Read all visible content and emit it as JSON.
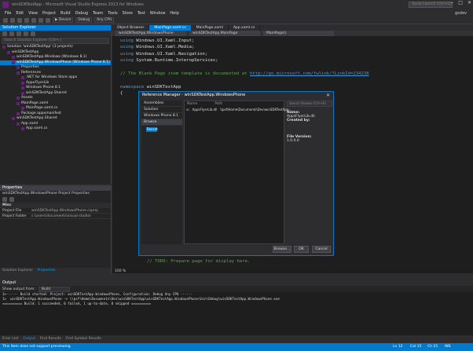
{
  "window": {
    "title": "winSDKTestApp - Microsoft Visual Studio Express 2013 for Windows",
    "quick_launch": "Quick Launch (Ctrl+Q)",
    "user": "gsdev"
  },
  "menu": [
    "File",
    "Edit",
    "View",
    "Project",
    "Build",
    "Debug",
    "Team",
    "Tools",
    "Store",
    "Test",
    "Window",
    "Help"
  ],
  "toolbar": {
    "device": "Device",
    "config": "Debug",
    "platform": "Any CPU"
  },
  "solution_explorer": {
    "title": "Solution Explorer",
    "search_placeholder": "Search Solution Explorer (Ctrl+;)",
    "items": [
      {
        "label": "Solution 'winSDKTestApp' (3 projects)",
        "indent": 0,
        "selected": false
      },
      {
        "label": "winSDKTestApp",
        "indent": 1,
        "selected": false
      },
      {
        "label": "winSDKTestApp.Windows (Windows 8.1)",
        "indent": 2,
        "selected": false
      },
      {
        "label": "winSDKTestApp.WindowsPhone (Windows Phone 8.1)",
        "indent": 2,
        "selected": true
      },
      {
        "label": "Properties",
        "indent": 3,
        "selected": false
      },
      {
        "label": "References",
        "indent": 3,
        "selected": false
      },
      {
        "label": ".NET for Windows Store apps",
        "indent": 4,
        "selected": false
      },
      {
        "label": "AppxFlyerLib",
        "indent": 4,
        "selected": false
      },
      {
        "label": "Windows Phone 8.1",
        "indent": 4,
        "selected": false
      },
      {
        "label": "winSDKTestApp.Shared",
        "indent": 4,
        "selected": false
      },
      {
        "label": "Assets",
        "indent": 3,
        "selected": false
      },
      {
        "label": "MainPage.xaml",
        "indent": 3,
        "selected": false
      },
      {
        "label": "MainPage.xaml.cs",
        "indent": 4,
        "selected": false
      },
      {
        "label": "Package.appxmanifest",
        "indent": 3,
        "selected": false
      },
      {
        "label": "winSDKTestApp.Shared",
        "indent": 2,
        "selected": false
      },
      {
        "label": "App.xaml",
        "indent": 3,
        "selected": false
      },
      {
        "label": "App.xaml.cs",
        "indent": 4,
        "selected": false
      }
    ]
  },
  "properties": {
    "title": "Properties",
    "subject": "winSDKTestApp.WindowsPhone  Project Properties",
    "section": "Misc",
    "rows": [
      {
        "k": "Project File",
        "v": "winSDKTestApp.WindowsPhone.csproj"
      },
      {
        "k": "Project Folder",
        "v": "c:\\users\\documents\\visual studio\\"
      }
    ],
    "tabs": [
      "Solution Explorer",
      "Properties"
    ]
  },
  "editor": {
    "tabs": [
      "Object Browser",
      "MainPage.xaml.cs",
      "MainPage.xaml",
      "App.xaml.cs"
    ],
    "nav": [
      "winSDKTestApp.WindowsPhone",
      "winSDKTestApp.MainPage",
      "MainPage()"
    ],
    "zoom": "100 %",
    "lines": [
      {
        "t": "using Windows.UI.Xaml.Input;",
        "c": "tx"
      },
      {
        "t": "using Windows.UI.Xaml.Media;",
        "c": "tx"
      },
      {
        "t": "using Windows.UI.Xaml.Navigation;",
        "c": "tx"
      },
      {
        "t": "using System.Runtime.InteropServices;",
        "c": "tx"
      },
      {
        "t": "",
        "c": "tx"
      },
      {
        "t": "// The Blank Page item template is documented at http://go.microsoft.com/fwlink/?LinkId=234238",
        "c": "cm"
      },
      {
        "t": "",
        "c": "tx"
      },
      {
        "t": "namespace winSDKTestApp",
        "c": "tx"
      },
      {
        "t": "{",
        "c": "tx"
      }
    ],
    "tail": "// TODO: Prepare page for display here."
  },
  "dialog": {
    "title": "Reference Manager - winSDKTestApp.WindowsPhone",
    "categories": [
      "Assemblies",
      "Solution",
      "Windows Phone 8.1",
      "Browse"
    ],
    "recent": "Recent",
    "search": "Search Browse (Ctrl+E)",
    "columns": [
      "Name",
      "Path"
    ],
    "rows": [
      {
        "name": "AppsFlyerLib.dll",
        "path": "\\\\psf\\Home\\Documents\\Dev\\winSDKTestApp..."
      }
    ],
    "detail": {
      "name_label": "Name:",
      "name": "AppsFlyerLib.dll",
      "created_label": "Created by:",
      "version_label": "File Version:",
      "version": "1.0.0.0"
    },
    "buttons": {
      "browse": "Browse...",
      "ok": "OK",
      "cancel": "Cancel"
    }
  },
  "output": {
    "title": "Output",
    "show_from_label": "Show output from:",
    "show_from_value": "Build",
    "lines": [
      "1>------ Build started: Project: winSDKTestApp.WindowsPhone, Configuration: Debug Any CPU ------",
      "1>  winSDKTestApp.WindowsPhone -> \\\\psf\\Home\\Documents\\Dev\\winSDKTestApp\\winSDKTestApp.WindowsPhone\\bin\\Debug\\winSDKTestApp.WindowsPhone.exe",
      "========== Build: 1 succeeded, 0 failed, 1 up-to-date, 0 skipped =========="
    ],
    "tabs": [
      "Error List",
      "Output",
      "Find Results",
      "Find Symbol Results"
    ]
  },
  "status": {
    "text": "This item does not support previewing",
    "ln": "Ln 12",
    "col": "Col 15",
    "ch": "Ch 15",
    "mode": "INS"
  }
}
